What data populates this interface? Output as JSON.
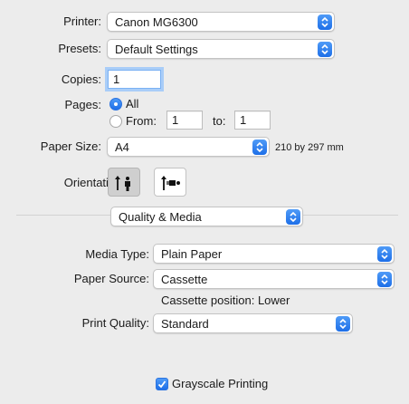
{
  "printer": {
    "label": "Printer:",
    "value": "Canon MG6300"
  },
  "presets": {
    "label": "Presets:",
    "value": "Default Settings"
  },
  "copies": {
    "label": "Copies:",
    "value": "1"
  },
  "pages": {
    "label": "Pages:",
    "all_label": "All",
    "from_label": "From:",
    "from_value": "1",
    "to_label": "to:",
    "to_value": "1",
    "selected": "All"
  },
  "paper_size": {
    "label": "Paper Size:",
    "value": "A4",
    "dimensions": "210 by 297 mm"
  },
  "orientation": {
    "label": "Orientation:",
    "selected": "portrait"
  },
  "section_menu": {
    "value": "Quality & Media"
  },
  "media_type": {
    "label": "Media Type:",
    "value": "Plain Paper"
  },
  "paper_source": {
    "label": "Paper Source:",
    "value": "Cassette",
    "note": "Cassette position: Lower"
  },
  "print_quality": {
    "label": "Print Quality:",
    "value": "Standard"
  },
  "grayscale": {
    "label": "Grayscale Printing",
    "checked": true
  },
  "colors": {
    "accent": "#1e6fe8",
    "background": "#ececec"
  }
}
